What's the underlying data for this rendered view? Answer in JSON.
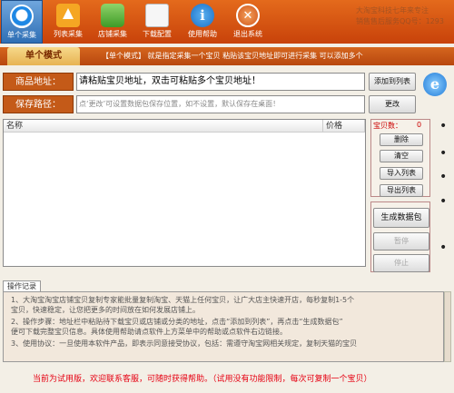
{
  "toolbar": {
    "items": [
      {
        "label": "单个采集",
        "icon": "single-collect-icon",
        "active": true
      },
      {
        "label": "列表采集",
        "icon": "list-collect-icon",
        "active": false
      },
      {
        "label": "店铺采集",
        "icon": "shop-collect-icon",
        "active": false
      },
      {
        "label": "下载配置",
        "icon": "download-config-icon",
        "active": false
      },
      {
        "label": "使用帮助",
        "icon": "help-icon",
        "active": false
      },
      {
        "label": "退出系统",
        "icon": "exit-icon",
        "active": false
      }
    ],
    "watermark_line1": "大淘宝科技七年来专注",
    "watermark_line2": "销售售后服务QQ号：1293"
  },
  "mode": {
    "tab_label": "单个模式",
    "description": "【单个模式】 就是指定采集一个宝贝 粘贴该宝贝地址即可进行采集 可以添加多个"
  },
  "url_field": {
    "label": "商品地址：",
    "value": "请粘贴宝贝地址，双击可粘贴多个宝贝地址！",
    "add_button": "添加到列表"
  },
  "path_field": {
    "label": "保存路径：",
    "value": "点‘更改’可设置数据包保存位置，如不设置，默认保存在桌面！",
    "change_button": "更改"
  },
  "table": {
    "columns": [
      "名称",
      "价格"
    ],
    "rows": []
  },
  "side_panel": {
    "count_label": "宝贝数：",
    "count_value": "0",
    "buttons": [
      "删除",
      "清空",
      "导入列表",
      "导出列表"
    ]
  },
  "actions": {
    "generate": "生成数据包",
    "pause": "暂停",
    "stop": "停止"
  },
  "log": {
    "tab_label": "操作记录",
    "lines": [
      "1、大淘宝淘宝店铺宝贝复制专家能批量复制淘宝、天猫上任何宝贝，让广大店主快速开店，每秒复制1-5个",
      "宝贝，快速稳定，让您把更多的时间放在如何发展店铺上。",
      "2、操作步骤：地址栏中粘贴待下载宝贝或店铺或分类的地址，点击“添加到列表”，再点击“生成数据包”",
      "便可下载完整宝贝信息。具体使用帮助请点软件上方菜单中的帮助或点软件右边链接。",
      "3、使用协议：一旦使用本软件产品，即表示同意接受协议，包括：需遵守淘宝网相关规定，复制天猫的宝贝"
    ]
  },
  "footer": {
    "text": "当前为试用版，欢迎联系客服，可随时获得帮助。（试用没有功能限制，每次可复制一个宝贝）"
  }
}
